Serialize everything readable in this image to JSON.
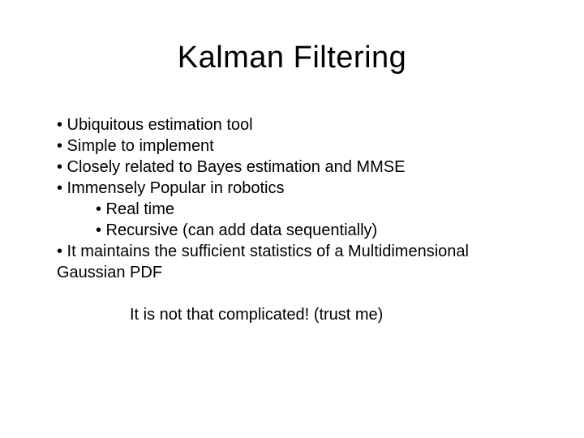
{
  "title": "Kalman Filtering",
  "bullets": {
    "b1": "• Ubiquitous estimation tool",
    "b2": "• Simple to implement",
    "b3": "• Closely related to Bayes estimation and MMSE",
    "b4": "• Immensely Popular in robotics",
    "b4a": "• Real time",
    "b4b": "• Recursive (can add data sequentially)",
    "b5a": "• It maintains the sufficient statistics of a Multidimensional",
    "b5b": "Gaussian PDF"
  },
  "closing": "It is not that complicated! (trust me)"
}
